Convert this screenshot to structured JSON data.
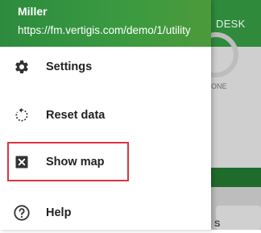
{
  "background": {
    "header_text": "DESK",
    "card_text": "ONE",
    "lower_text": "S"
  },
  "drawer": {
    "user_name": "Miller",
    "url": "https://fm.vertigis.com/demo/1/utility",
    "items": [
      {
        "label": "Settings",
        "icon": "gear-icon"
      },
      {
        "label": "Reset data",
        "icon": "reset-icon"
      },
      {
        "label": "Show map",
        "icon": "close-box-icon"
      },
      {
        "label": "Help",
        "icon": "help-icon"
      }
    ]
  },
  "colors": {
    "header_green": "#2c8b3e",
    "highlight_red": "#d9363e"
  }
}
